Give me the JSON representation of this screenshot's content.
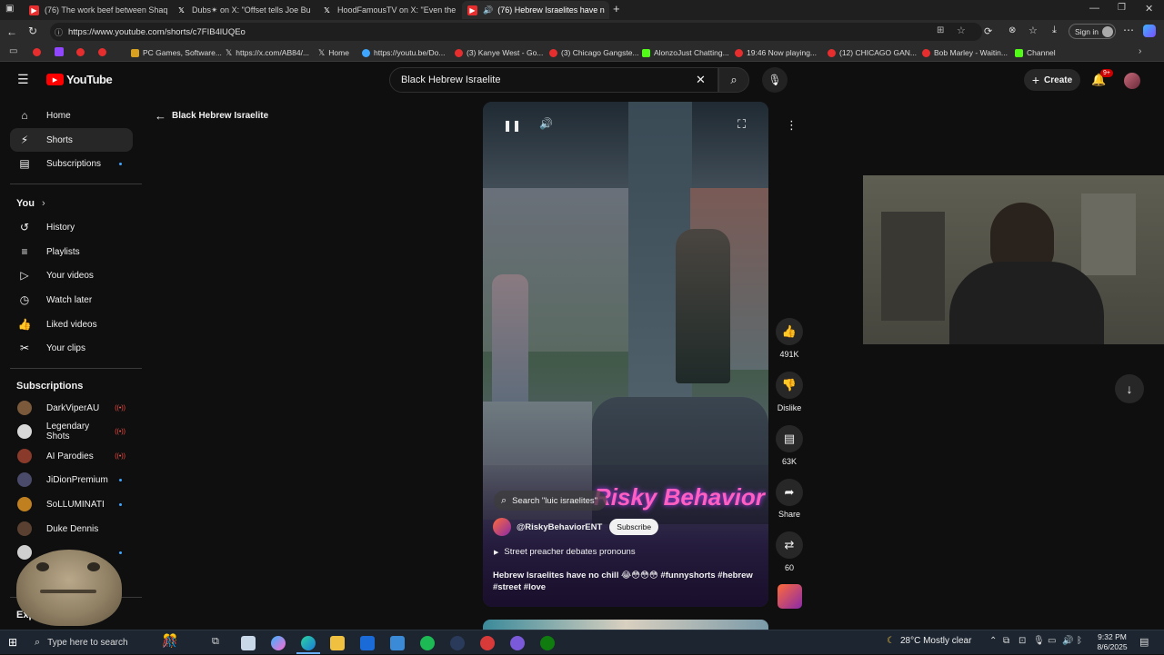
{
  "browser": {
    "tabs": [
      {
        "title": "(76) The work beef between Shaq",
        "icon": "youtube-icon"
      },
      {
        "title": "Dubs✴ on X: \"Offset tells Joe Bu",
        "icon": "x-icon"
      },
      {
        "title": "HoodFamousTV on X: \"Even the",
        "icon": "x-icon"
      },
      {
        "title": "(76) Hebrew Israelites have n",
        "icon": "youtube-icon"
      }
    ],
    "url": "https://www.youtube.com/shorts/c7FIB4lUQEo",
    "sign_in": "Sign in",
    "bookmarks": [
      "PC Games, Software...",
      "https://x.com/AB84/...",
      "Home",
      "https://youtu.be/Do...",
      "(3) Kanye West - Go...",
      "(3) Chicago Gangste...",
      "AlonzoJust Chatting...",
      "19:46 Now playing...",
      "(12) CHICAGO GAN...",
      "Bob Marley - Waitin...",
      "Channel"
    ]
  },
  "youtube": {
    "logo_text": "YouTube",
    "search_value": "Black Hebrew Israelite",
    "create_label": "Create",
    "notification_count": "9+",
    "back_label": "Black Hebrew Israelite",
    "nav": [
      {
        "label": "Home",
        "icon": "home-icon"
      },
      {
        "label": "Shorts",
        "icon": "shorts-icon"
      },
      {
        "label": "Subscriptions",
        "icon": "subscriptions-icon"
      }
    ],
    "you_label": "You",
    "you_items": [
      {
        "label": "History",
        "icon": "history-icon"
      },
      {
        "label": "Playlists",
        "icon": "playlists-icon"
      },
      {
        "label": "Your videos",
        "icon": "your-videos-icon"
      },
      {
        "label": "Watch later",
        "icon": "watch-later-icon"
      },
      {
        "label": "Liked videos",
        "icon": "liked-videos-icon"
      },
      {
        "label": "Your clips",
        "icon": "clips-icon"
      }
    ],
    "subscriptions_label": "Subscriptions",
    "subscriptions": [
      {
        "name": "DarkViperAU",
        "status": "live",
        "color": "#7a5a3a"
      },
      {
        "name": "Legendary Shots",
        "status": "live",
        "color": "#d8d8d8"
      },
      {
        "name": "AI Parodies",
        "status": "live",
        "color": "#8a3a2a"
      },
      {
        "name": "JiDionPremium",
        "status": "new",
        "color": "#4a4a6a"
      },
      {
        "name": "SoLLUMINATI",
        "status": "new",
        "color": "#c08020"
      },
      {
        "name": "Duke Dennis",
        "status": "none",
        "color": "#5a4030"
      }
    ],
    "explore_partial": "Exp"
  },
  "short": {
    "search_chip": "Search \"luic israelites\"",
    "channel": "@RiskyBehaviorENT",
    "subscribe_label": "Subscribe",
    "playlist_label": "Street preacher debates pronouns",
    "description": "Hebrew Israelites have no chill 😂😳😳😳 #funnyshorts #hebrew #street #love",
    "overlay_logo": "Risky Behavior",
    "likes": "491K",
    "dislike_label": "Dislike",
    "comments": "63K",
    "share_label": "Share",
    "remix_count": "60"
  },
  "taskbar": {
    "search_placeholder": "Type here to search",
    "weather": "28°C  Mostly clear",
    "time": "9:32 PM",
    "date": "8/6/2025"
  }
}
